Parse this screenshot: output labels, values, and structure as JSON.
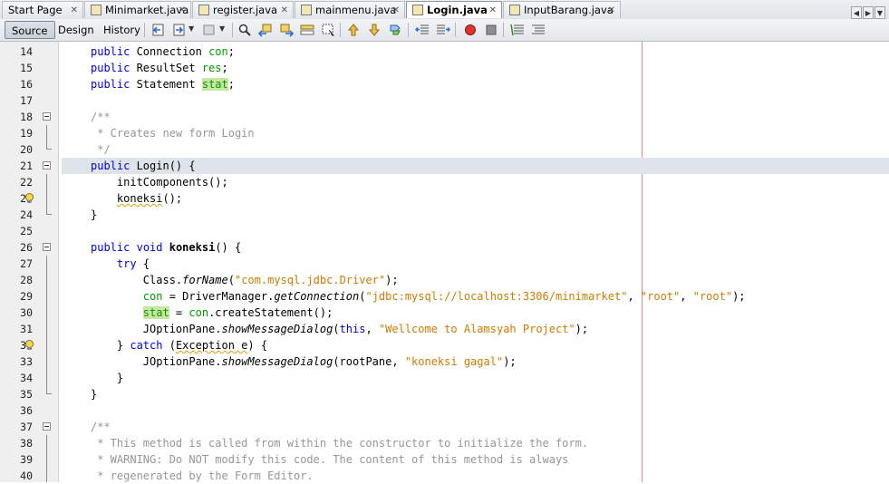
{
  "tabs": [
    {
      "label": "Start Page",
      "active": false
    },
    {
      "label": "Minimarket.java",
      "active": false
    },
    {
      "label": "register.java",
      "active": false
    },
    {
      "label": "mainmenu.java",
      "active": false
    },
    {
      "label": "Login.java",
      "active": true
    },
    {
      "label": "InputBarang.java",
      "active": false
    }
  ],
  "toolbar": {
    "source_label": "Source",
    "design_label": "Design",
    "history_label": "History"
  },
  "lines": [
    {
      "n": "14",
      "t": "public Connection con;"
    },
    {
      "n": "15",
      "t": "public ResultSet res;"
    },
    {
      "n": "16",
      "t": "public Statement stat;"
    },
    {
      "n": "17",
      "t": ""
    },
    {
      "n": "18",
      "t": "/**"
    },
    {
      "n": "19",
      "t": " * Creates new form Login"
    },
    {
      "n": "20",
      "t": " */"
    },
    {
      "n": "21",
      "t": "public Login() {"
    },
    {
      "n": "22",
      "t": "    initComponents();"
    },
    {
      "n": "23",
      "t": "    koneksi();"
    },
    {
      "n": "24",
      "t": "}"
    },
    {
      "n": "25",
      "t": ""
    },
    {
      "n": "26",
      "t": "public void koneksi() {"
    },
    {
      "n": "27",
      "t": "    try {"
    },
    {
      "n": "28",
      "t": "        Class.forName(\"com.mysql.jdbc.Driver\");"
    },
    {
      "n": "29",
      "t": "        con = DriverManager.getConnection(\"jdbc:mysql://localhost:3306/minimarket\", \"root\", \"root\");"
    },
    {
      "n": "30",
      "t": "        stat = con.createStatement();"
    },
    {
      "n": "31",
      "t": "        JOptionPane.showMessageDialog(this, \"Wellcome to Alamsyah Project\");"
    },
    {
      "n": "32",
      "t": "    } catch (Exception e) {"
    },
    {
      "n": "33",
      "t": "        JOptionPane.showMessageDialog(rootPane, \"koneksi gagal\");"
    },
    {
      "n": "34",
      "t": "    }"
    },
    {
      "n": "35",
      "t": "}"
    },
    {
      "n": "36",
      "t": ""
    },
    {
      "n": "37",
      "t": "/**"
    },
    {
      "n": "38",
      "t": " * This method is called from within the constructor to initialize the form."
    },
    {
      "n": "39",
      "t": " * WARNING: Do NOT modify this code. The content of this method is always"
    },
    {
      "n": "40",
      "t": " * regenerated by the Form Editor."
    }
  ],
  "colors": {
    "keyword": "#0000e6",
    "string": "#ce7b00",
    "field": "#009900",
    "comment": "#969696",
    "current_line": "#dfe3ea",
    "right_margin": "#e38a8a"
  },
  "icons": [
    "file-icon",
    "close-icon",
    "back-icon",
    "forward-icon",
    "search-icon",
    "find-previous-icon",
    "find-next-icon",
    "toggle-highlight-icon",
    "find-selection-icon",
    "previous-bookmark-icon",
    "next-bookmark-icon",
    "toggle-bookmark-icon",
    "shift-left-icon",
    "shift-right-icon",
    "record-macro-icon",
    "stop-macro-icon",
    "comment-icon",
    "uncomment-icon",
    "fold-icon",
    "hint-bulb-icon"
  ]
}
